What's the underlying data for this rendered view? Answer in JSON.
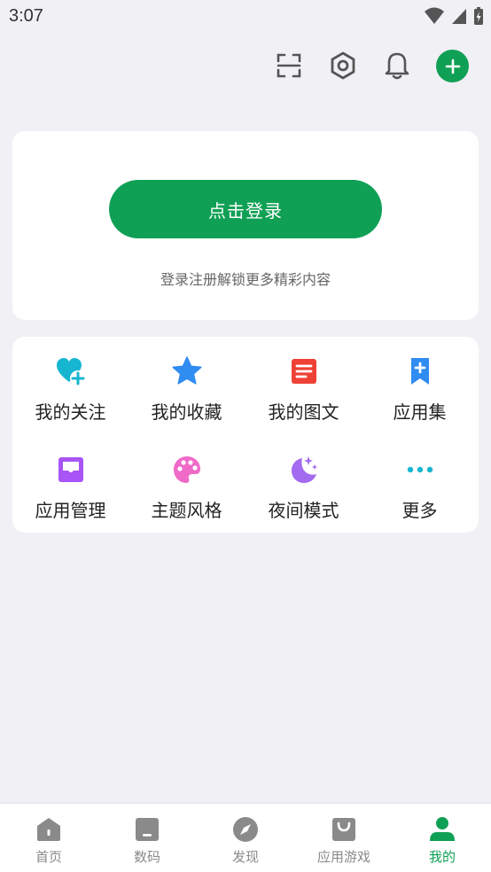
{
  "status_bar": {
    "time": "3:07"
  },
  "toolbar": {
    "icons": [
      "scan-icon",
      "settings-icon",
      "bell-icon",
      "add-icon"
    ]
  },
  "login": {
    "button_label": "点击登录",
    "hint": "登录注册解锁更多精彩内容"
  },
  "menu": {
    "items": [
      {
        "label": "我的关注",
        "icon": "heart-plus-icon",
        "color": "#16b6d0"
      },
      {
        "label": "我的收藏",
        "icon": "star-icon",
        "color": "#2f8cf0"
      },
      {
        "label": "我的图文",
        "icon": "document-icon",
        "color": "#ef4136"
      },
      {
        "label": "应用集",
        "icon": "bookmark-plus-icon",
        "color": "#2f8cf0"
      },
      {
        "label": "应用管理",
        "icon": "inbox-icon",
        "color": "#a855f7"
      },
      {
        "label": "主题风格",
        "icon": "palette-icon",
        "color": "#f06bc8"
      },
      {
        "label": "夜间模式",
        "icon": "moon-stars-icon",
        "color": "#a36bf0"
      },
      {
        "label": "更多",
        "icon": "more-dots-icon",
        "color": "#16b6d0"
      }
    ]
  },
  "bottom_nav": {
    "items": [
      {
        "label": "首页",
        "icon": "home-icon"
      },
      {
        "label": "数码",
        "icon": "device-icon"
      },
      {
        "label": "发现",
        "icon": "compass-icon"
      },
      {
        "label": "应用游戏",
        "icon": "shopping-bag-icon"
      },
      {
        "label": "我的",
        "icon": "person-icon",
        "active": true
      }
    ],
    "active_color": "#10a055",
    "inactive_color": "#8a8a8a"
  }
}
